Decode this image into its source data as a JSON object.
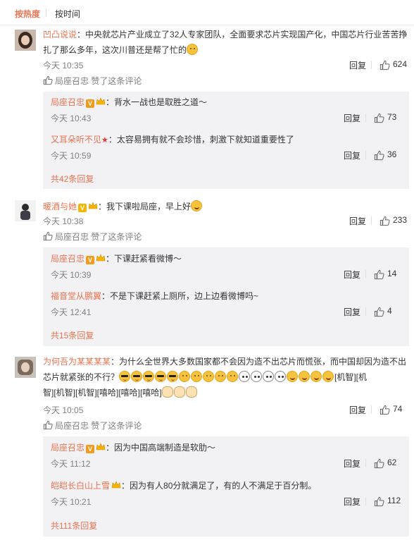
{
  "tabs": {
    "hot": "按热度",
    "time": "按时间"
  },
  "comments": [
    {
      "user": "凹凸说说",
      "text": "：中央就芯片产业成立了32人专家团队，全面要求芯片实现国产化，中国芯片行业苦苦挣",
      "text2": "扎了那么多年，这次川普还是帮了忙的",
      "time": "今天 10:35",
      "reply": "回复",
      "likes": "624",
      "liked_by": "局座召忠 赞了这条评论",
      "replies": [
        {
          "user": "局座召忠",
          "text": "：背水一战也是取胜之道～",
          "time": "今天 10:43",
          "reply": "回复",
          "likes": "73"
        },
        {
          "user": "又耳朵听不见",
          "text": "：太容易拥有就不会珍惜，刺激下就知道重要性了",
          "time": "今天 10:59",
          "reply": "回复",
          "likes": "36"
        }
      ],
      "more": "共42条回复"
    },
    {
      "user": "暖酒与她",
      "text": "：我下课啦局座，早上好",
      "time": "今天 10:38",
      "reply": "回复",
      "likes": "233",
      "liked_by": "局座召忠 赞了这条评论",
      "replies": [
        {
          "user": "局座召忠",
          "text": "：下课赶紧看微博～",
          "time": "今天 10:39",
          "reply": "回复",
          "likes": "14"
        },
        {
          "user": "福音堂从鹏翼",
          "text": "：不是下课赶紧上厕所，边上边看微博吗~",
          "time": "今天 12:41",
          "reply": "回复",
          "likes": "4"
        }
      ],
      "more": "共15条回复"
    },
    {
      "user": "为何吾为某某某某",
      "text": "：为什么全世界大多数国家都不会因为造不出芯片而慌张，而中国却因为造不出",
      "text2": "芯片就紧张的不行？",
      "text2b": "[机智][机",
      "text3": "智][机智][机智][嘻哈][嘻哈][嘻哈]",
      "time": "今天 10:05",
      "reply": "回复",
      "likes": "74",
      "liked_by": "局座召忠 赞了这条评论",
      "replies": [
        {
          "user": "局座召忠",
          "text": "：因为中国高端制造是软肋～",
          "time": "今天 11:12",
          "reply": "回复",
          "likes": "62"
        },
        {
          "user": "皑皑长白山上雪",
          "text": "：因为有人80分就满足了，有的人不满足于百分制。",
          "time": "今天 10:21",
          "reply": "回复",
          "likes": "112"
        }
      ],
      "more": "共111条回复"
    }
  ],
  "colors": {
    "accent": "#eb7350",
    "reply_bg": "#f2f2f5",
    "meta": "#808080"
  },
  "icons": [
    "thumb-up-icon",
    "verified-badge-icon",
    "crown-icon",
    "star-icon"
  ]
}
